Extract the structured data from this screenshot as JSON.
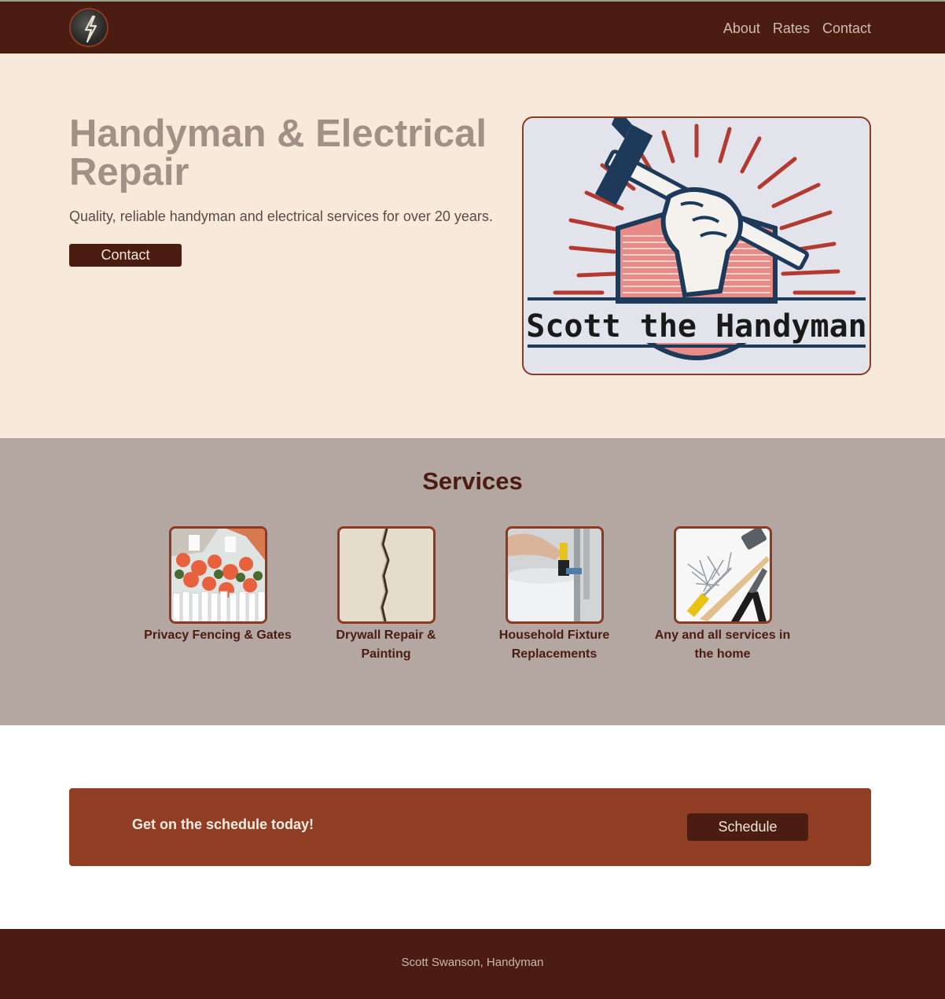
{
  "colors": {
    "nav_bg": "#4a1c12",
    "hero_bg": "#f8eadb",
    "services_bg": "#b4a7a1",
    "cta_bg": "#913f24",
    "accent_border": "#8e3a22",
    "title_muted": "#a28f85"
  },
  "nav": {
    "logo_icon": "lightning-bolt-icon",
    "links": [
      "About",
      "Rates",
      "Contact"
    ]
  },
  "hero": {
    "title": "Handyman & Electrical Repair",
    "subtitle": "Quality, reliable handyman and electrical services for over 20 years.",
    "button_label": "Contact",
    "logo_text": "Scott the Handyman"
  },
  "services": {
    "title": "Services",
    "items": [
      {
        "label": "Privacy Fencing & Gates"
      },
      {
        "label": "Drywall Repair & Painting"
      },
      {
        "label": "Household Fixture Replacements"
      },
      {
        "label": "Any and all services in the home"
      }
    ]
  },
  "cta": {
    "text": "Get on the schedule today!",
    "button_label": "Schedule"
  },
  "footer": {
    "text": "Scott Swanson, Handyman"
  }
}
